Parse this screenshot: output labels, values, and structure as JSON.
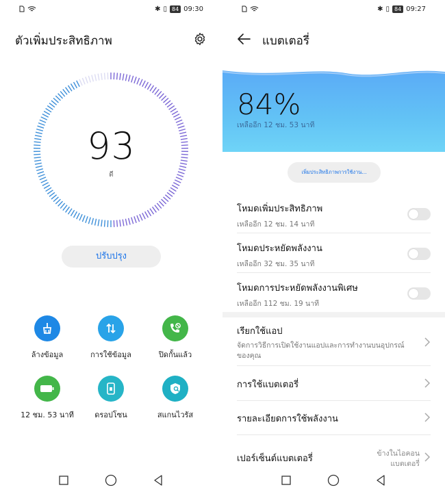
{
  "left": {
    "status": {
      "time": "09:30",
      "battery": "84"
    },
    "title": "ตัวเพิ่มประสิทธิภาพ",
    "score": "93",
    "score_label": "ดี",
    "improve_label": "ปรับปรุง",
    "tools": [
      {
        "label": "ล้างข้อมูล",
        "icon": "broom-icon",
        "color": "#1e88e5"
      },
      {
        "label": "การใช้ข้อมูล",
        "icon": "data-transfer-icon",
        "color": "#29a3e8"
      },
      {
        "label": "ปิดกั้นแล้ว",
        "icon": "phone-block-icon",
        "color": "#43b649"
      },
      {
        "label": "12 ชม. 53 นาที",
        "icon": "battery-icon",
        "color": "#43b649"
      },
      {
        "label": "ดรอปโซน",
        "icon": "phone-drop-icon",
        "color": "#26b5c7"
      },
      {
        "label": "สแกนไวรัส",
        "icon": "shield-scan-icon",
        "color": "#1fb0c4"
      }
    ]
  },
  "right": {
    "status": {
      "time": "09:27",
      "battery": "84"
    },
    "title": "แบตเตอรี่",
    "percent": "84%",
    "remaining": "เหลืออีก 12 ชม. 53 นาที",
    "optimize_label": "เพิ่มประสิทธิภาพการใช้งาน...",
    "modes": [
      {
        "title": "โหมดเพิ่มประสิทธิภาพ",
        "sub": "เหลืออีก 12 ชม. 14 นาที",
        "on": false
      },
      {
        "title": "โหมดประหยัดพลังงาน",
        "sub": "เหลืออีก 32 ชม. 35 นาที",
        "on": false
      },
      {
        "title": "โหมดการประหยัดพลังงานพิเศษ",
        "sub": "เหลืออีก 112 ชม. 19 นาที",
        "on": false
      }
    ],
    "app_launch": {
      "title": "เรียกใช้แอป",
      "sub": "จัดการวิธีการเปิดใช้งานแอปและการทำงานบนอุปกรณ์ของคุณ"
    },
    "battery_usage": "การใช้แบตเตอรี่",
    "power_details": "รายละเอียดการใช้พลังงาน",
    "battery_percent": {
      "title": "เปอร์เซ็นต์แบตเตอรี่",
      "value": "ข้างในไอคอนแบตเตอรี่"
    }
  },
  "colors": {
    "accent": "#1a73e8",
    "gauge": "#5b6fd0"
  }
}
